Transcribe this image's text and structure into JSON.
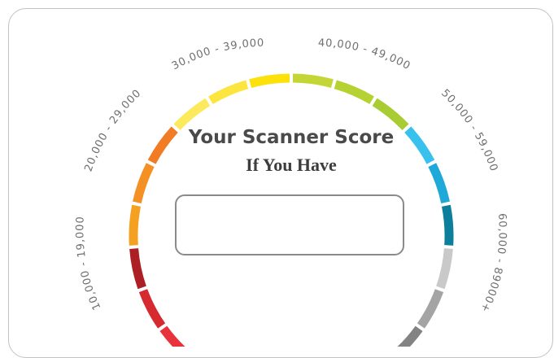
{
  "header": {
    "title": "Your Scanner Score",
    "subtitle": "If You Have"
  },
  "score_box": {
    "value": ""
  },
  "gauge": {
    "ranges": [
      {
        "label": "10,000 - 19,000"
      },
      {
        "label": "20,000 - 29,000"
      },
      {
        "label": "30,000 - 39,000"
      },
      {
        "label": "40,000 - 49,000"
      },
      {
        "label": "50,000 - 59,000"
      },
      {
        "label": "60,000 - 89000+"
      }
    ],
    "segment_colors": [
      "#e8333c",
      "#d52a30",
      "#ac1f25",
      "#f4a122",
      "#f59024",
      "#f27b25",
      "#fdea5c",
      "#fde540",
      "#fde10a",
      "#c3d636",
      "#b6d232",
      "#a8cc32",
      "#37c1ec",
      "#1fa9d8",
      "#0c7f9d",
      "#c9c9c9",
      "#a4a4a4",
      "#838383"
    ]
  }
}
